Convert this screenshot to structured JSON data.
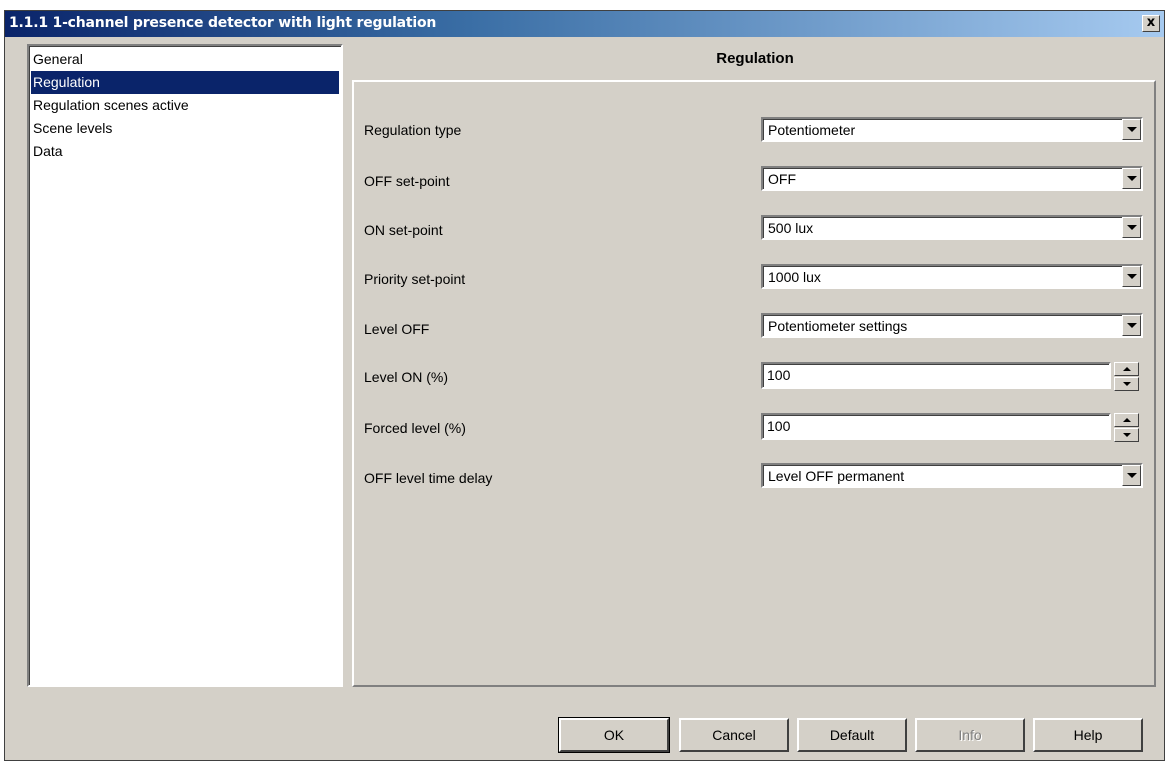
{
  "window": {
    "title": "1.1.1 1-channel presence detector with light regulation",
    "close_symbol": "x"
  },
  "sidebar": {
    "items": [
      {
        "label": "General",
        "selected": false
      },
      {
        "label": "Regulation",
        "selected": true
      },
      {
        "label": "Regulation scenes active",
        "selected": false
      },
      {
        "label": "Scene levels",
        "selected": false
      },
      {
        "label": "Data",
        "selected": false
      }
    ]
  },
  "page": {
    "heading": "Regulation"
  },
  "params": [
    {
      "label": "Regulation type",
      "control": "dropdown",
      "value": "Potentiometer"
    },
    {
      "label": "OFF set-point",
      "control": "dropdown",
      "value": "OFF"
    },
    {
      "label": "ON set-point",
      "control": "dropdown",
      "value": "500 lux"
    },
    {
      "label": "Priority set-point",
      "control": "dropdown",
      "value": "1000 lux"
    },
    {
      "label": "Level OFF",
      "control": "dropdown",
      "value": "Potentiometer settings"
    },
    {
      "label": "Level ON (%)",
      "control": "spinner",
      "value": "100"
    },
    {
      "label": "Forced level (%)",
      "control": "spinner",
      "value": "100"
    },
    {
      "label": "OFF level time delay",
      "control": "dropdown",
      "value": "Level OFF permanent"
    }
  ],
  "buttons": {
    "ok": "OK",
    "cancel": "Cancel",
    "default": "Default",
    "info": "Info",
    "help": "Help"
  },
  "icons": {
    "close": "close-icon",
    "dropdown": "chevron-down-icon",
    "spin_up": "spin-up-icon",
    "spin_down": "spin-down-icon"
  },
  "colors": {
    "selection": "#0a246a",
    "dialog_bg": "#d4d0c8",
    "title_gradient_start": "#0a246a",
    "title_gradient_end": "#a6caf0"
  }
}
